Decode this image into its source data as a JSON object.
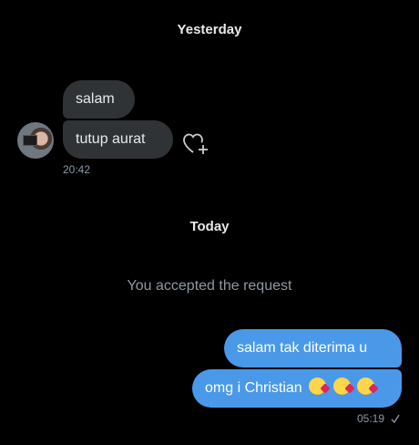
{
  "separators": {
    "yesterday": "Yesterday",
    "today": "Today"
  },
  "incoming": {
    "messages": [
      "salam",
      "tutup aurat"
    ],
    "time": "20:42",
    "react_icon": "heart-plus-icon",
    "avatar_icon": "profile-photo"
  },
  "system": {
    "accepted": "You accepted the request"
  },
  "outgoing": {
    "messages": [
      "salam tak diterima u",
      "omg i Christian"
    ],
    "emoji": [
      "kissing-face-emoji",
      "kissing-face-emoji",
      "kissing-face-emoji"
    ],
    "time": "05:19",
    "status_icon": "sent-check-icon"
  },
  "colors": {
    "background": "#000000",
    "incoming_bubble": "#2f3336",
    "outgoing_bubble": "#4a99e9",
    "muted_text": "#8b98a5"
  }
}
